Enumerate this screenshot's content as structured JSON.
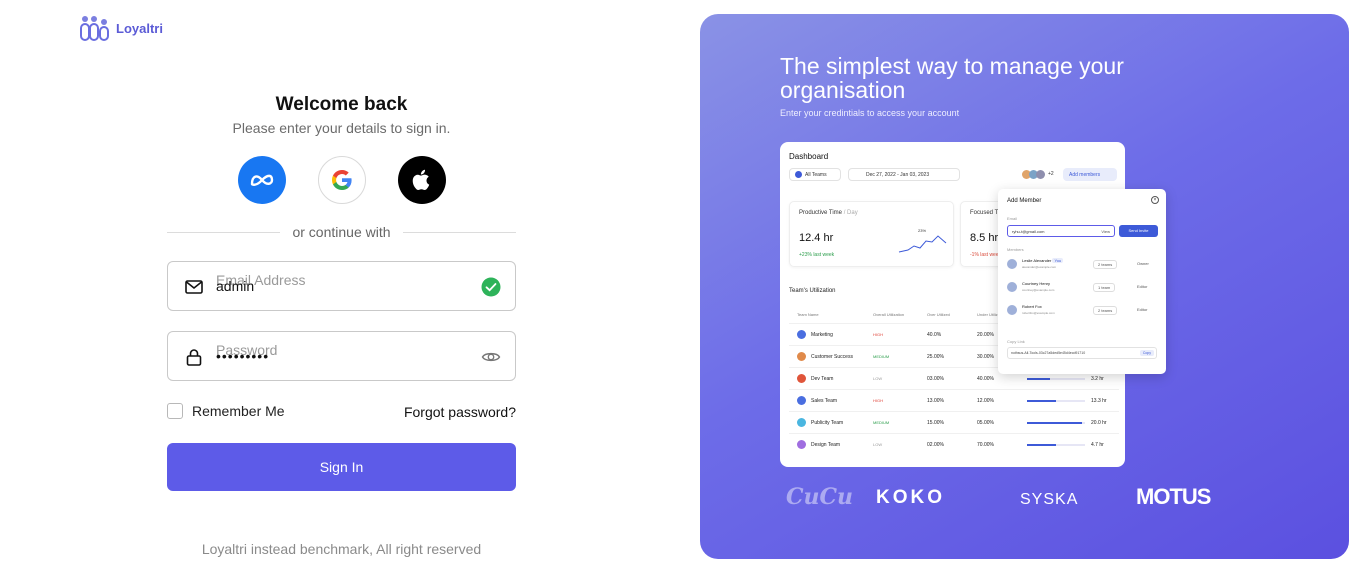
{
  "app": {
    "name": "Loyaltri"
  },
  "login": {
    "title": "Welcome back",
    "subtitle": "Please enter your details to sign in.",
    "social_providers": [
      "meta-icon",
      "google-icon",
      "apple-icon"
    ],
    "divider_text": "or continue with",
    "email": {
      "label": "Email Address",
      "value": "admin",
      "valid": true
    },
    "password": {
      "label": "Password",
      "value": "•••••••••"
    },
    "remember_label": "Remember Me",
    "remember_checked": false,
    "forgot_label": "Forgot password?",
    "signin_label": "Sign In",
    "footer": "Loyaltri instead benchmark, All right reserved"
  },
  "hero": {
    "title": "The simplest way to manage your organisation",
    "subtitle": "Enter your credintials to access your account",
    "dashboard": {
      "title": "Dashboard",
      "team_filter": "All Teams",
      "date_range": "Dec 27, 2022 - Jan 03, 2023",
      "avatar_extra": "+2",
      "add_members": "Add members",
      "productive": {
        "label": "Productive Time",
        "period": "/ Day",
        "value": "12.4 hr",
        "change": "+23% last week",
        "peak": "23%"
      },
      "focused": {
        "label": "Focused Tim",
        "value": "8.5 hr",
        "change": "-1% last wee"
      },
      "utilization_title": "Team's Utilization",
      "columns": [
        "Team Name",
        "Overall Utilization",
        "Over Utilized",
        "Under Utiliz"
      ],
      "rows": [
        {
          "name": "Marketing",
          "flag": "HIGH",
          "c1": "40.0%",
          "c2": "20.00%",
          "hours": "",
          "bar": 0.6,
          "color": "#4a6ee0",
          "flag_color": "#e0453a"
        },
        {
          "name": "Customer Success",
          "flag": "MEDIUM",
          "c1": "25.00%",
          "c2": "30.00%",
          "hours": "",
          "bar": 0.5,
          "color": "#e08a4a",
          "flag_color": "#2a9d4a"
        },
        {
          "name": "Dev Team",
          "flag": "LOW",
          "c1": "03.00%",
          "c2": "40.00%",
          "hours": "3.2 hr",
          "bar": 0.4,
          "color": "#e0553a",
          "flag_color": "#999999"
        },
        {
          "name": "Sales Team",
          "flag": "HIGH",
          "c1": "13.00%",
          "c2": "12.00%",
          "hours": "13.3 hr",
          "bar": 0.5,
          "color": "#4a6ee0",
          "flag_color": "#e0453a"
        },
        {
          "name": "Publicity Team",
          "flag": "MEDIUM",
          "c1": "15.00%",
          "c2": "05.00%",
          "hours": "20.0 hr",
          "bar": 0.95,
          "color": "#4ab6e0",
          "flag_color": "#2a9d4a"
        },
        {
          "name": "Design Team",
          "flag": "LOW",
          "c1": "02.00%",
          "c2": "70.00%",
          "hours": "4.7 hr",
          "bar": 0.5,
          "color": "#a06ee0",
          "flag_color": "#999999"
        }
      ]
    },
    "modal": {
      "title": "Add Member",
      "email_label": "Email",
      "email_value": "ryhu-t@gmail.com",
      "role": "View",
      "send": "Send Invite",
      "members_label": "Members",
      "members": [
        {
          "name": "Leslie Alexander",
          "tag": "You",
          "mail": "alexander@example.com",
          "teams": "2 teams",
          "role": "Owner"
        },
        {
          "name": "Courtney Henry",
          "tag": "",
          "mail": "courtney@example.com",
          "teams": "1 team",
          "role": "Editor"
        },
        {
          "name": "Robert Fox",
          "tag": "",
          "mail": "robertfox@example.com",
          "teams": "2 teams",
          "role": "Editor"
        }
      ],
      "copy_label": "Copy Link",
      "link": "nothsus-All-Tools-03c27a5ded5e45d4ecd91710",
      "copy": "Copy"
    },
    "brands": [
      "CuCu",
      "KOKO",
      "SYSKA",
      "MOTUS"
    ]
  }
}
